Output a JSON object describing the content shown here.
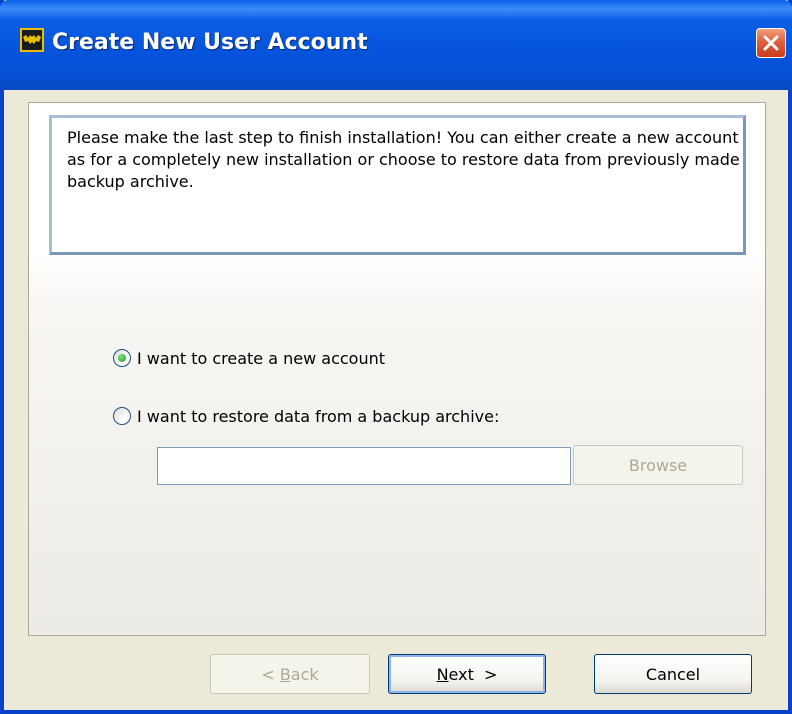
{
  "window": {
    "title": "Create New User Account",
    "app_icon": "batman-logo-icon",
    "close_icon": "close-icon",
    "colors": {
      "titlebar": "#0654dc",
      "close_button": "#e06040",
      "frame": "#ece9d8"
    }
  },
  "info": {
    "message": "Please make the last step to finish installation! You can either create a new account as for a completely new installation or choose to restore data from previously made backup archive."
  },
  "options": {
    "create_label": "I want to create a new account",
    "create_selected": true,
    "restore_label": "I want to restore data from a backup archive:",
    "restore_selected": false,
    "archive_path_value": "",
    "browse_label": "Browse",
    "browse_enabled": false
  },
  "footer": {
    "back_prefix": "< ",
    "back_mnemonic": "B",
    "back_rest": "ack",
    "back_enabled": false,
    "next_mnemonic": "N",
    "next_rest": "ext  >",
    "cancel_label": "Cancel"
  }
}
